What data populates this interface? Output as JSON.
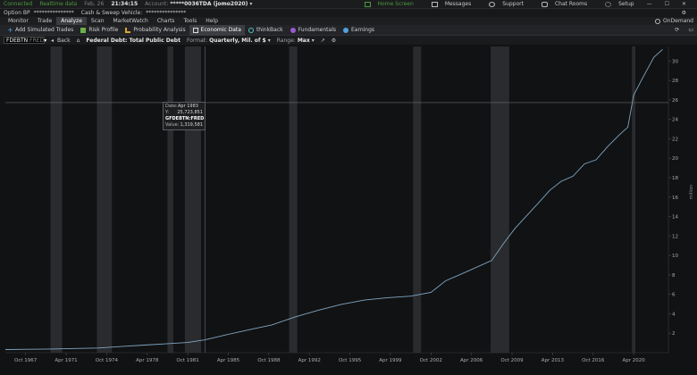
{
  "status": {
    "connected": "Connected",
    "realtime": "Realtime data",
    "date": "Feb, 26",
    "time": "21:34:15",
    "account_label": "Account:",
    "account_value": "*****0036TDA (jomo2020)",
    "home_screen": "Home Screen",
    "messages": "Messages",
    "support": "Support",
    "chat_rooms": "Chat Rooms",
    "setup": "Setup"
  },
  "account": {
    "option_bp_label": "Option BP",
    "option_bp_value": "***************",
    "cash_label": "Cash & Sweep Vehicle:",
    "cash_value": "***************"
  },
  "tabs": [
    "Monitor",
    "Trade",
    "Analyze",
    "Scan",
    "MarketWatch",
    "Charts",
    "Tools",
    "Help"
  ],
  "active_tab": "Analyze",
  "ondemand": "OnDemand",
  "subtabs": [
    "Add Simulated Trades",
    "Risk Profile",
    "Probability Analysis",
    "Economic Data",
    "thinkBack",
    "Fundamentals",
    "Earnings"
  ],
  "active_subtab": "Economic Data",
  "toolbar": {
    "symbol": "FDEBTN",
    "symbol_suffix": ":FRED",
    "back": "Back",
    "series_title": "Federal Debt: Total Public Debt",
    "format_label": "Format:",
    "format_value": "Quarterly, Mil. of $",
    "range_label": "Range:",
    "range_value": "Max"
  },
  "tooltip": {
    "date_label": "Date:",
    "date_value": "Apr 1983",
    "y_label": "Y:",
    "y_value": "25,723,851",
    "series": "GFDEBTN:FRED",
    "value_label": "Value:",
    "value_value": "1,319,581"
  },
  "axis_unit": "million",
  "colors": {
    "background": "#111213",
    "line": "#7fa6c4",
    "recession": "#2a2b2e",
    "crosshair": "#7b7d80",
    "grid": "#1f2124"
  },
  "chart_data": {
    "type": "line",
    "y_ticks": [
      2,
      4,
      6,
      8,
      10,
      12,
      14,
      16,
      18,
      20,
      22,
      24,
      26,
      28,
      30
    ],
    "ylim": [
      0,
      31.5
    ],
    "y_unit": "million",
    "x_ticks": [
      "Oct 1967",
      "Apr 1971",
      "Oct 1974",
      "Apr 1978",
      "Oct 1981",
      "Apr 1985",
      "Oct 1988",
      "Apr 1992",
      "Oct 1995",
      "Apr 1999",
      "Oct 2002",
      "Apr 2006",
      "Oct 2009",
      "Apr 2013",
      "Oct 2016",
      "Apr 2020"
    ],
    "x_tick_years": [
      1967.75,
      1971.25,
      1974.75,
      1978.25,
      1981.75,
      1985.25,
      1988.75,
      1992.25,
      1995.75,
      1999.25,
      2002.75,
      2006.25,
      2009.75,
      2013.25,
      2016.75,
      2020.25
    ],
    "xlim": [
      1966.0,
      2023.25
    ],
    "series": [
      {
        "points": [
          [
            1966.0,
            0.32
          ],
          [
            1968.0,
            0.35
          ],
          [
            1970.0,
            0.38
          ],
          [
            1972.0,
            0.43
          ],
          [
            1974.0,
            0.48
          ],
          [
            1976.0,
            0.63
          ],
          [
            1978.0,
            0.78
          ],
          [
            1980.0,
            0.93
          ],
          [
            1981.75,
            1.05
          ],
          [
            1983.25,
            1.32
          ],
          [
            1985.0,
            1.82
          ],
          [
            1987.0,
            2.35
          ],
          [
            1989.0,
            2.86
          ],
          [
            1991.0,
            3.66
          ],
          [
            1993.0,
            4.35
          ],
          [
            1995.0,
            4.97
          ],
          [
            1997.0,
            5.41
          ],
          [
            1999.0,
            5.66
          ],
          [
            2001.0,
            5.81
          ],
          [
            2002.75,
            6.2
          ],
          [
            2004.0,
            7.38
          ],
          [
            2006.0,
            8.42
          ],
          [
            2008.0,
            9.49
          ],
          [
            2009.0,
            11.2
          ],
          [
            2010.0,
            12.78
          ],
          [
            2012.0,
            15.36
          ],
          [
            2013.0,
            16.7
          ],
          [
            2014.0,
            17.63
          ],
          [
            2015.0,
            18.15
          ],
          [
            2016.0,
            19.41
          ],
          [
            2017.0,
            19.84
          ],
          [
            2018.0,
            21.2
          ],
          [
            2019.0,
            22.39
          ],
          [
            2019.75,
            23.2
          ],
          [
            2020.25,
            26.48
          ],
          [
            2021.0,
            28.2
          ],
          [
            2022.0,
            30.4
          ],
          [
            2022.75,
            31.2
          ]
        ]
      }
    ],
    "recessions": [
      [
        1969.9,
        1970.9
      ],
      [
        1973.9,
        1975.2
      ],
      [
        1980.0,
        1980.5
      ],
      [
        1981.5,
        1982.9
      ],
      [
        1990.5,
        1991.2
      ],
      [
        2001.2,
        2001.9
      ],
      [
        2007.9,
        2009.5
      ],
      [
        2020.1,
        2020.4
      ]
    ],
    "crosshair": {
      "x": 1983.25,
      "y": 25.72
    },
    "grid": false
  }
}
